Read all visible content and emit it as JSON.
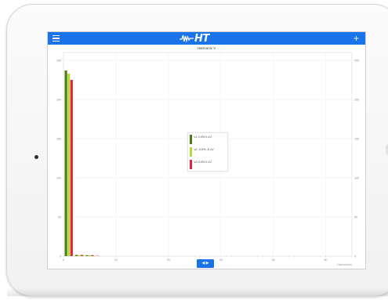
{
  "app": {
    "logo_text": "HT"
  },
  "chart_data": {
    "type": "bar",
    "title": "Harmonic V",
    "xlabel": "Harmonics",
    "ylabel": "",
    "y_ticks": [
      "0",
      "50",
      "100",
      "150",
      "200",
      "250"
    ],
    "x_ticks": [
      "0",
      "10",
      "20",
      "30",
      "40",
      "50"
    ],
    "ylim": [
      0,
      260
    ],
    "xlim": [
      0,
      55
    ],
    "grid": true,
    "categories": [
      "1",
      "2",
      "3",
      "4",
      "5",
      "6"
    ],
    "series": [
      {
        "name": "v1",
        "color": "#4d7d14",
        "values": [
          237,
          0.4,
          1.5,
          0.4,
          1.2,
          0.4
        ]
      },
      {
        "name": "v2",
        "color": "#b7dc3a",
        "values": [
          233,
          0.4,
          1.5,
          0.4,
          1.2,
          0.4
        ]
      },
      {
        "name": "v3",
        "color": "#e8213f",
        "values": [
          225,
          0.4,
          1.5,
          0.4,
          1.2,
          0.4
        ]
      }
    ],
    "legend": {
      "placement": "center",
      "entries": [
        {
          "label": "v1 0.0% 0.1V",
          "color": "#4d7d14"
        },
        {
          "label": "v2 -0.0% -0.1V",
          "color": "#b7dc3a"
        },
        {
          "label": "v3 0.0% 0.1V",
          "color": "#e8213f"
        }
      ]
    }
  },
  "nav": {
    "toggle_label": "◀ ▶"
  }
}
